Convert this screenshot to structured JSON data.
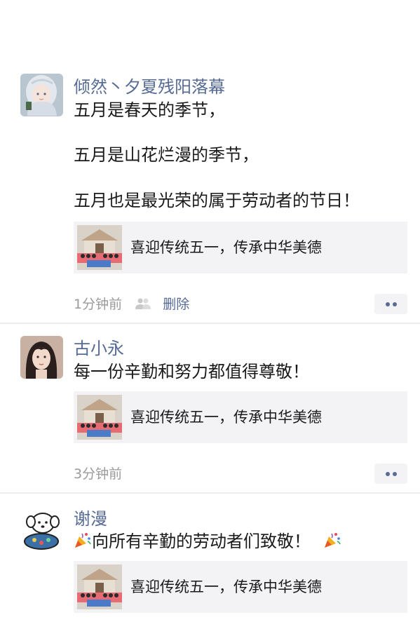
{
  "posts": [
    {
      "author": "倾然丶夕夏残阳落幕",
      "lines": [
        "五月是春天的季节，",
        "五月是山花烂漫的季节，",
        "五月也是最光荣的属于劳动者的节日！"
      ],
      "link_title": "喜迎传统五一，传承中华美德",
      "time": "1分钟前",
      "delete_label": "删除",
      "visibility_icon": "friends-icon",
      "avatar_icon": "girl-silver-hair-avatar"
    },
    {
      "author": "古小永",
      "lines": [
        "每一份辛勤和努力都值得尊敬！"
      ],
      "link_title": "喜迎传统五一，传承中华美德",
      "time": "3分钟前",
      "avatar_icon": "girl-photo-avatar"
    },
    {
      "author": "谢漫",
      "lines": [
        "向所有辛勤的劳动者们致敬！"
      ],
      "emoji": "party-popper-icon",
      "link_title": "喜迎传统五一，传承中华美德",
      "avatar_icon": "cartoon-dog-avatar"
    }
  ],
  "colors": {
    "name": "#576b95",
    "text": "#1a1a1a",
    "meta": "#9a9a9a",
    "card_bg": "#f3f3f5"
  }
}
